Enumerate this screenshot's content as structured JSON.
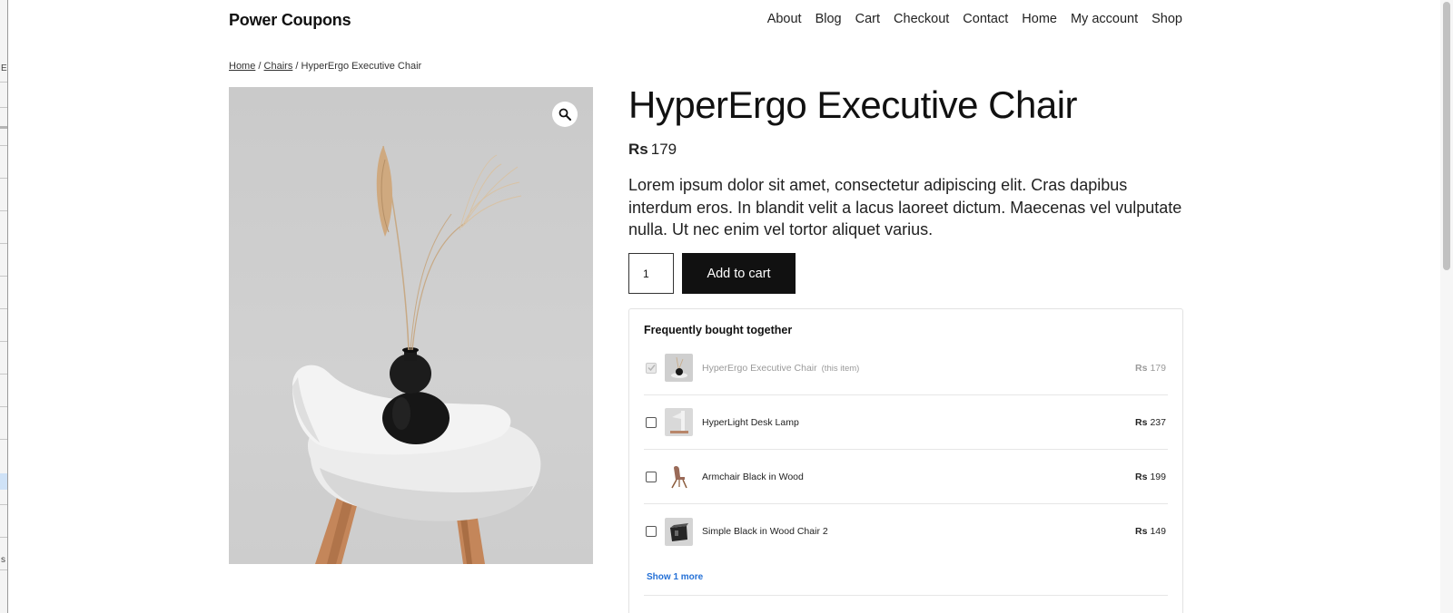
{
  "site": {
    "title": "Power Coupons"
  },
  "nav": {
    "items": [
      "About",
      "Blog",
      "Cart",
      "Checkout",
      "Contact",
      "Home",
      "My account",
      "Shop"
    ]
  },
  "breadcrumb": {
    "home": "Home",
    "category": "Chairs",
    "sep": "/",
    "current": "HyperErgo Executive Chair"
  },
  "product": {
    "title": "HyperErgo Executive Chair",
    "currency": "Rs",
    "price": "179",
    "description": "Lorem ipsum dolor sit amet, consectetur adipiscing elit. Cras dapibus interdum eros. In blandit velit a lacus laoreet dictum. Maecenas vel vulputate nulla. Ut nec enim vel tortor aliquet varius.",
    "quantity": "1",
    "add_to_cart_label": "Add to cart",
    "zoom_icon": "magnifier-icon"
  },
  "fbt": {
    "title": "Frequently bought together",
    "items": [
      {
        "name": "HyperErgo Executive Chair",
        "note": "(this item)",
        "currency": "Rs",
        "price": "179",
        "checked": true,
        "disabled": true
      },
      {
        "name": "HyperLight Desk Lamp",
        "note": "",
        "currency": "Rs",
        "price": "237",
        "checked": false,
        "disabled": false
      },
      {
        "name": "Armchair Black in Wood",
        "note": "",
        "currency": "Rs",
        "price": "199",
        "checked": false,
        "disabled": false
      },
      {
        "name": "Simple Black in Wood Chair 2",
        "note": "",
        "currency": "Rs",
        "price": "149",
        "checked": false,
        "disabled": false
      }
    ],
    "show_more": "Show 1 more"
  },
  "colors": {
    "button_bg": "#111111",
    "link_blue": "#2470d6",
    "image_bg": "#cdcdcd"
  }
}
